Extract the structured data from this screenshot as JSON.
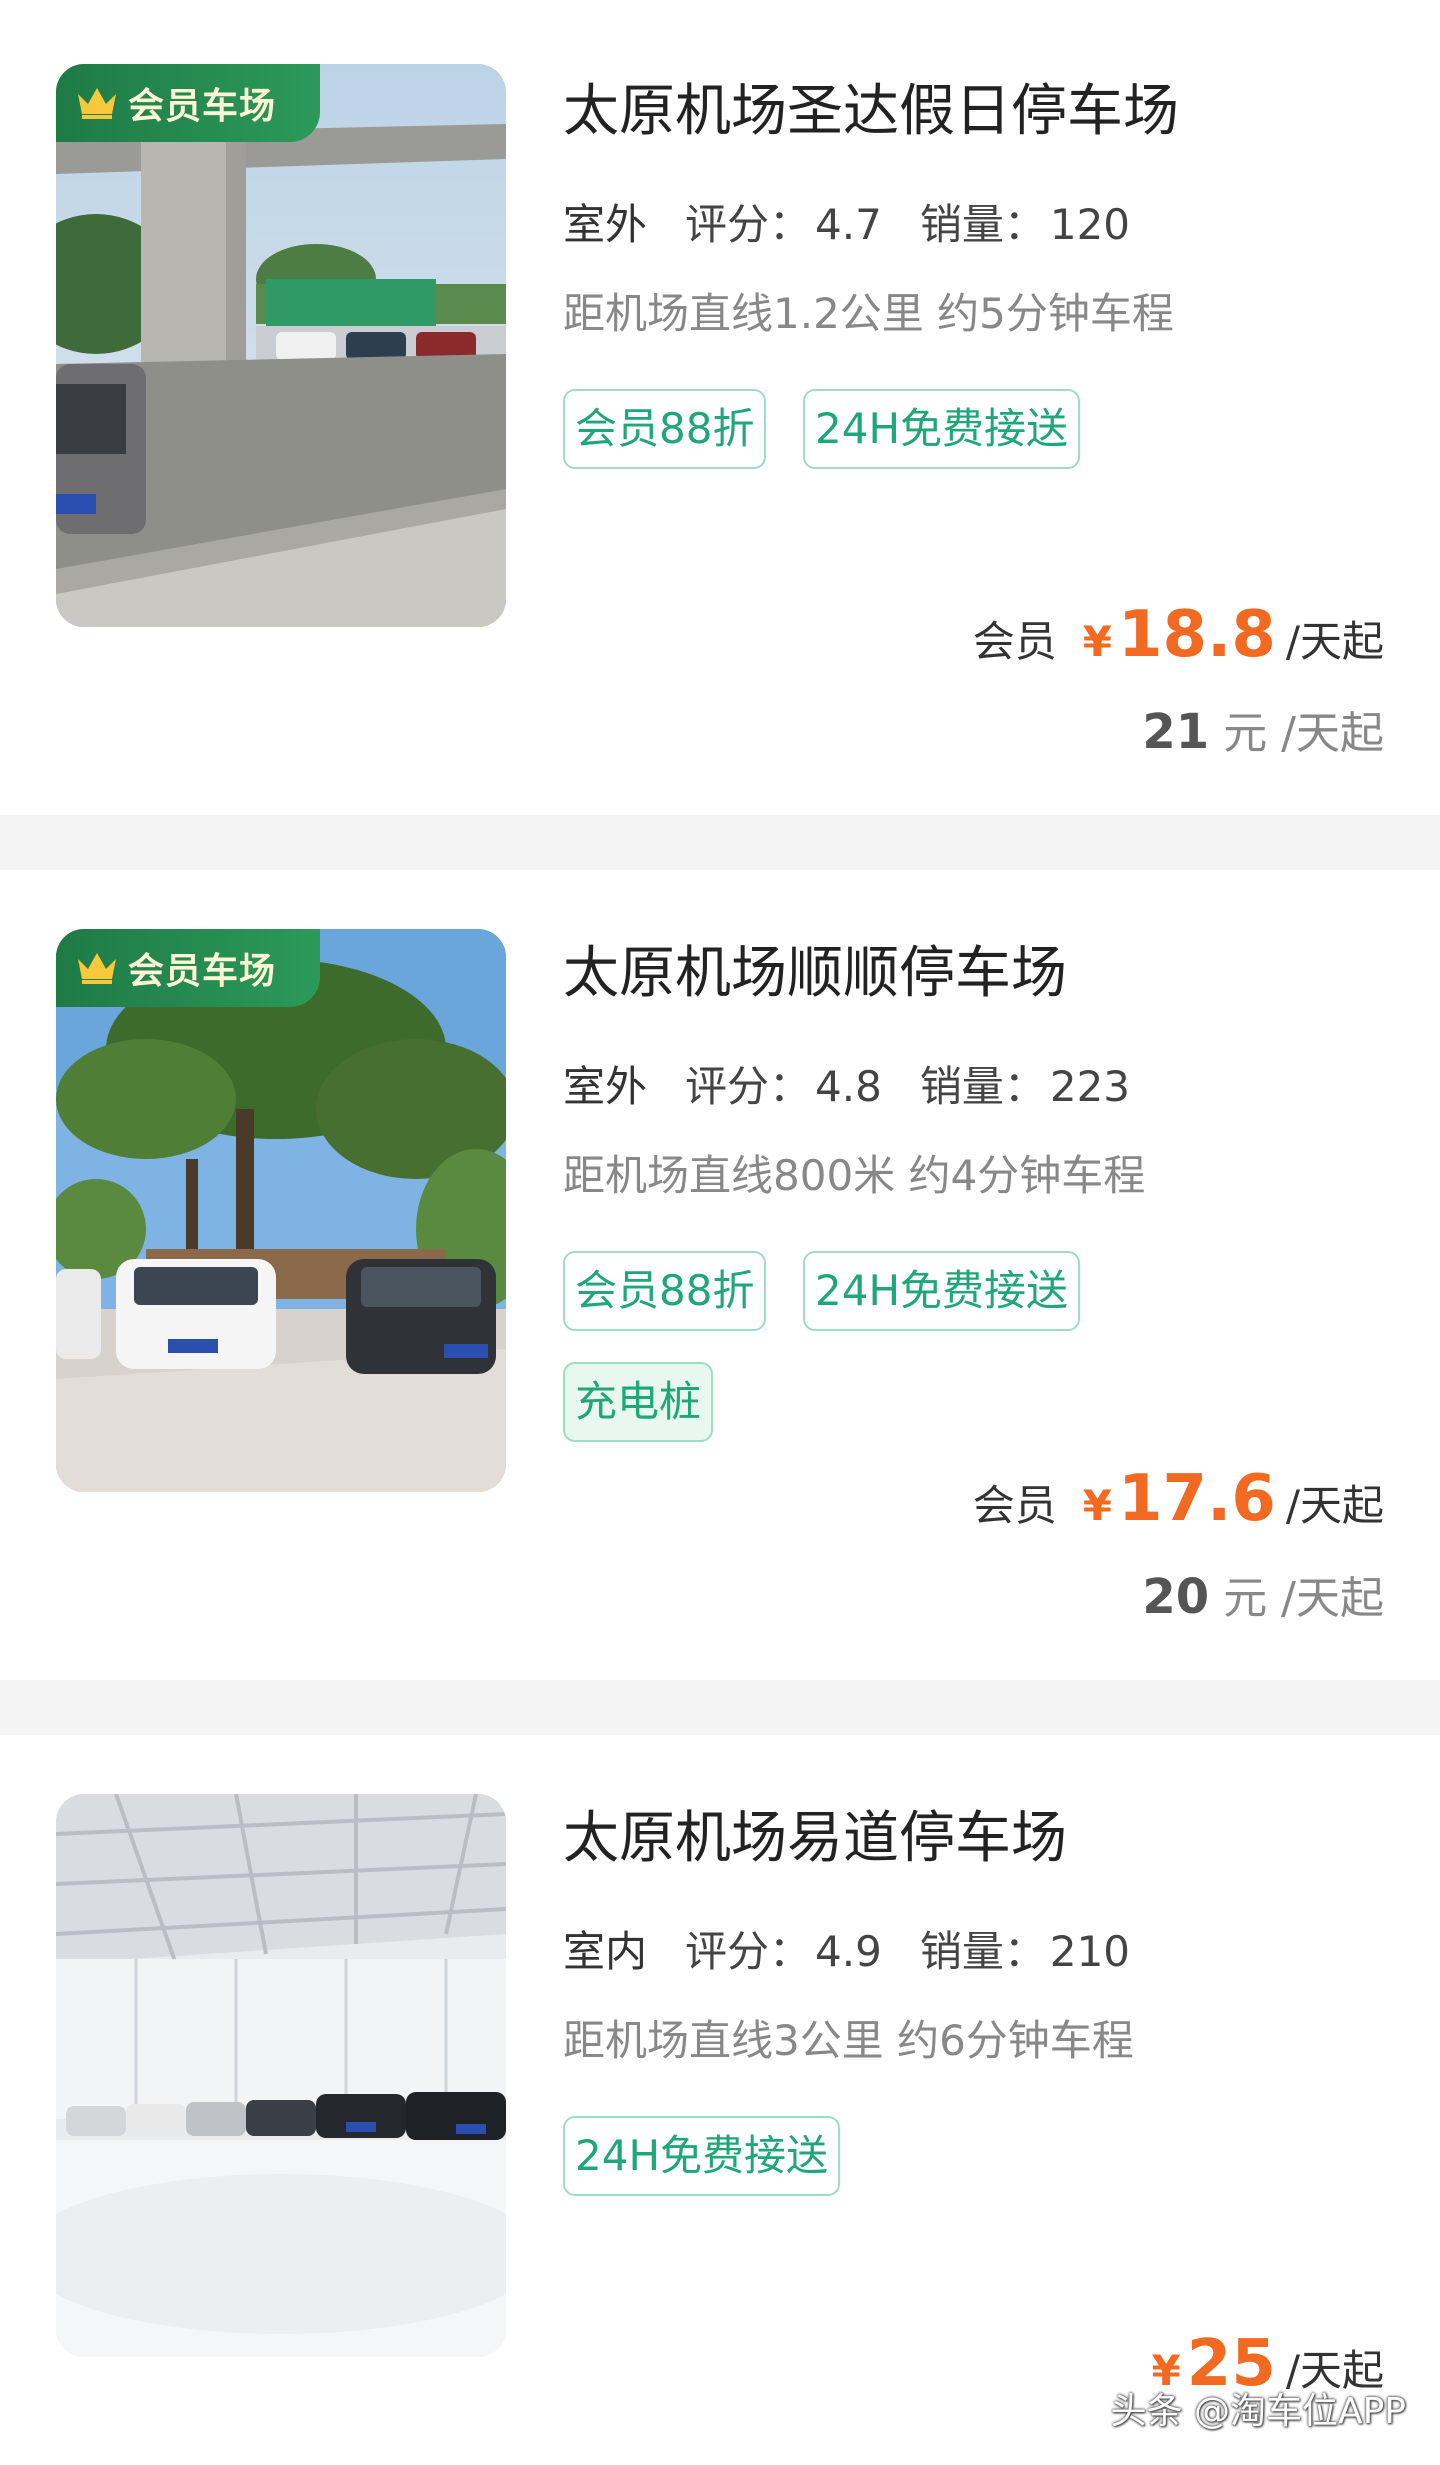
{
  "listings": [
    {
      "badge": "会员车场",
      "title": "太原机场圣达假日停车场",
      "location_type": "室外",
      "rating_label": "评分：",
      "rating": "4.7",
      "sales_label": "销量：",
      "sales": "120",
      "distance": "距机场直线1.2公里 约5分钟车程",
      "tags": [
        "会员88折",
        "24H免费接送"
      ],
      "member_label": "会员",
      "currency": "¥",
      "member_price": "18.8",
      "member_unit": "/天起",
      "regular_price": "21",
      "regular_unit": "元 /天起"
    },
    {
      "badge": "会员车场",
      "title": "太原机场顺顺停车场",
      "location_type": "室外",
      "rating_label": "评分：",
      "rating": "4.8",
      "sales_label": "销量：",
      "sales": "223",
      "distance": "距机场直线800米 约4分钟车程",
      "tags": [
        "会员88折",
        "24H免费接送",
        "充电桩"
      ],
      "member_label": "会员",
      "currency": "¥",
      "member_price": "17.6",
      "member_unit": "/天起",
      "regular_price": "20",
      "regular_unit": "元 /天起"
    },
    {
      "title": "太原机场易道停车场",
      "location_type": "室内",
      "rating_label": "评分：",
      "rating": "4.9",
      "sales_label": "销量：",
      "sales": "210",
      "distance": "距机场直线3公里 约6分钟车程",
      "tags": [
        "24H免费接送"
      ],
      "currency": "¥",
      "price": "25",
      "price_unit": "/天起"
    }
  ],
  "watermark": "头条 @淘车位APP",
  "colors": {
    "accent_green": "#1fa77a",
    "price_orange": "#f26a21",
    "badge_green": "#1f7a46"
  }
}
